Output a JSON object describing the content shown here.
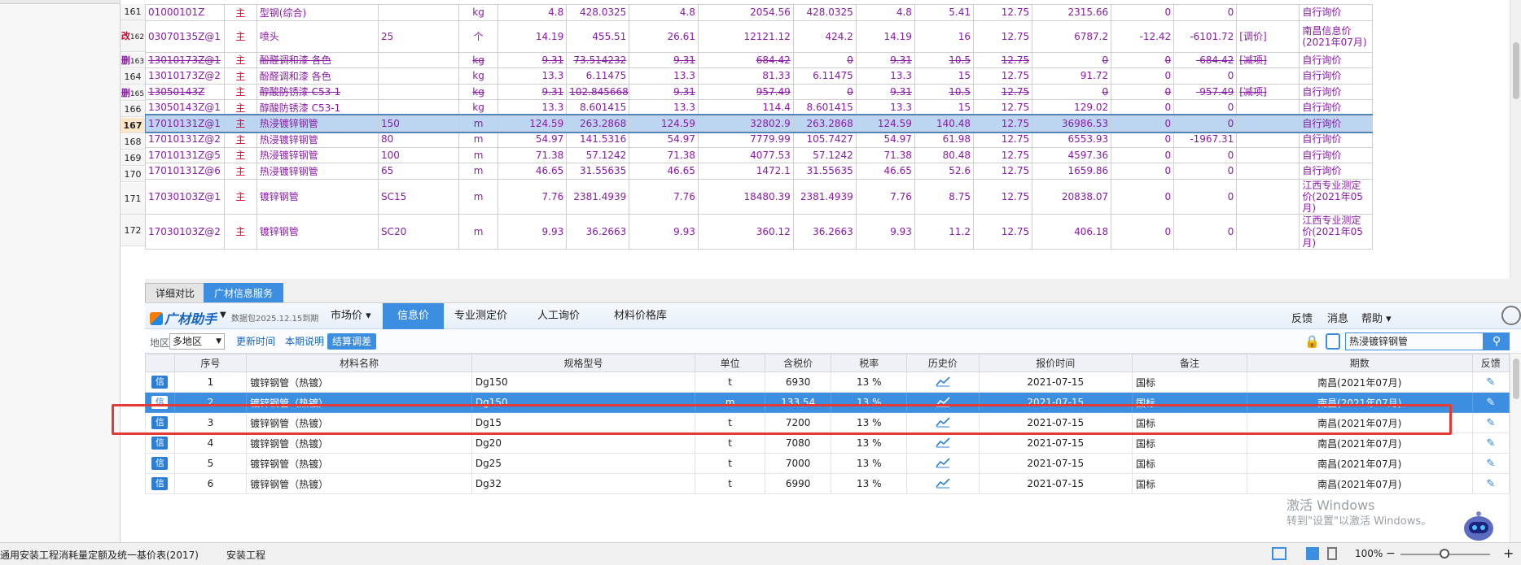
{
  "top_rows": [
    {
      "no": "161",
      "code": "01000101Z",
      "kind": "主",
      "name": "型钢(综合)",
      "spec": "",
      "unit": "kg",
      "v1": "4.8",
      "v2": "428.0325",
      "v3": "4.8",
      "v4": "2054.56",
      "v5": "428.0325",
      "v6": "4.8",
      "v7": "5.41",
      "v8": "12.75",
      "v9": "2315.66",
      "v10": "0",
      "v11": "0",
      "v12": "",
      "src": "自行询价",
      "style": "normal"
    },
    {
      "no": "162",
      "mark": "改",
      "code": "03070135Z@1",
      "kind": "主",
      "name": "喷头",
      "spec": "25",
      "unit": "个",
      "v1": "14.19",
      "v2": "455.51",
      "v3": "26.61",
      "v4": "12121.12",
      "v5": "424.2",
      "v6": "14.19",
      "v7": "16",
      "v8": "12.75",
      "v9": "6787.2",
      "v10": "-12.42",
      "v11": "-6101.72",
      "v12": "[调价]",
      "src": "南昌信息价(2021年07月)",
      "style": "tall"
    },
    {
      "no": "163",
      "mark": "删",
      "code": "13010173Z@1",
      "kind": "主",
      "name": "酚醛调和漆 各色",
      "spec": "",
      "unit": "kg",
      "v1": "9.31",
      "v2": "73.514232",
      "v3": "9.31",
      "v4": "684.42",
      "v5": "0",
      "v6": "9.31",
      "v7": "10.5",
      "v8": "12.75",
      "v9": "0",
      "v10": "0",
      "v11": "-684.42",
      "v12": "[减项]",
      "src": "自行询价",
      "style": "strike"
    },
    {
      "no": "164",
      "code": "13010173Z@2",
      "kind": "主",
      "name": "酚醛调和漆 各色",
      "spec": "",
      "unit": "kg",
      "v1": "13.3",
      "v2": "6.11475",
      "v3": "13.3",
      "v4": "81.33",
      "v5": "6.11475",
      "v6": "13.3",
      "v7": "15",
      "v8": "12.75",
      "v9": "91.72",
      "v10": "0",
      "v11": "0",
      "v12": "",
      "src": "自行询价",
      "style": "normal"
    },
    {
      "no": "165",
      "mark": "删",
      "code": "13050143Z",
      "kind": "主",
      "name": "醇酸防锈漆 C53-1",
      "spec": "",
      "unit": "kg",
      "v1": "9.31",
      "v2": "102.845668",
      "v3": "9.31",
      "v4": "957.49",
      "v5": "0",
      "v6": "9.31",
      "v7": "10.5",
      "v8": "12.75",
      "v9": "0",
      "v10": "0",
      "v11": "-957.49",
      "v12": "[减项]",
      "src": "自行询价",
      "style": "strike"
    },
    {
      "no": "166",
      "code": "13050143Z@1",
      "kind": "主",
      "name": "醇酸防锈漆 C53-1",
      "spec": "",
      "unit": "kg",
      "v1": "13.3",
      "v2": "8.601415",
      "v3": "13.3",
      "v4": "114.4",
      "v5": "8.601415",
      "v6": "13.3",
      "v7": "15",
      "v8": "12.75",
      "v9": "129.02",
      "v10": "0",
      "v11": "0",
      "v12": "",
      "src": "自行询价",
      "style": "normal"
    },
    {
      "no": "167",
      "code": "17010131Z@1",
      "kind": "主",
      "name": "热浸镀锌钢管",
      "spec": "150",
      "unit": "m",
      "v1": "124.59",
      "v2": "263.2868",
      "v3": "124.59",
      "v4": "32802.9",
      "v5": "263.2868",
      "v6": "124.59",
      "v7": "140.48",
      "v8": "12.75",
      "v9": "36986.53",
      "v10": "0",
      "v11": "0",
      "v12": "",
      "src": "自行询价",
      "style": "selected"
    },
    {
      "no": "168",
      "code": "17010131Z@2",
      "kind": "主",
      "name": "热浸镀锌钢管",
      "spec": "80",
      "unit": "m",
      "v1": "54.97",
      "v2": "141.5316",
      "v3": "54.97",
      "v4": "7779.99",
      "v5": "105.7427",
      "v6": "54.97",
      "v7": "61.98",
      "v8": "12.75",
      "v9": "6553.93",
      "v10": "0",
      "v11": "-1967.31",
      "v12": "",
      "src": "自行询价",
      "style": "normal"
    },
    {
      "no": "169",
      "code": "17010131Z@5",
      "kind": "主",
      "name": "热浸镀锌钢管",
      "spec": "100",
      "unit": "m",
      "v1": "71.38",
      "v2": "57.1242",
      "v3": "71.38",
      "v4": "4077.53",
      "v5": "57.1242",
      "v6": "71.38",
      "v7": "80.48",
      "v8": "12.75",
      "v9": "4597.36",
      "v10": "0",
      "v11": "0",
      "v12": "",
      "src": "自行询价",
      "style": "normal"
    },
    {
      "no": "170",
      "code": "17010131Z@6",
      "kind": "主",
      "name": "热浸镀锌钢管",
      "spec": "65",
      "unit": "m",
      "v1": "46.65",
      "v2": "31.55635",
      "v3": "46.65",
      "v4": "1472.1",
      "v5": "31.55635",
      "v6": "46.65",
      "v7": "52.6",
      "v8": "12.75",
      "v9": "1659.86",
      "v10": "0",
      "v11": "0",
      "v12": "",
      "src": "自行询价",
      "style": "normal"
    },
    {
      "no": "171",
      "code": "17030103Z@1",
      "kind": "主",
      "name": "镀锌钢管",
      "spec": "SC15",
      "unit": "m",
      "v1": "7.76",
      "v2": "2381.4939",
      "v3": "7.76",
      "v4": "18480.39",
      "v5": "2381.4939",
      "v6": "7.76",
      "v7": "8.75",
      "v8": "12.75",
      "v9": "20838.07",
      "v10": "0",
      "v11": "0",
      "v12": "",
      "src": "江西专业测定价(2021年05月)",
      "style": "tall"
    },
    {
      "no": "172",
      "code": "17030103Z@2",
      "kind": "主",
      "name": "镀锌钢管",
      "spec": "SC20",
      "unit": "m",
      "v1": "9.93",
      "v2": "36.2663",
      "v3": "9.93",
      "v4": "360.12",
      "v5": "36.2663",
      "v6": "9.93",
      "v7": "11.2",
      "v8": "12.75",
      "v9": "406.18",
      "v10": "0",
      "v11": "0",
      "v12": "",
      "src": "江西专业测定价(2021年05月)",
      "style": "tall"
    }
  ],
  "bottom_tabs": {
    "detail": "详细对比",
    "service": "广材信息服务"
  },
  "assistant": {
    "logo": "广材助手",
    "data_pkg": "数据包2025.12.15到期",
    "nav": [
      "市场价 ▾",
      "信息价",
      "专业测定价",
      "人工询价",
      "材料价格库"
    ],
    "right": [
      "反馈",
      "消息",
      "帮助 ▾"
    ]
  },
  "filters": {
    "region_label": "地区",
    "region_value": "多地区",
    "update_time": "更新时间",
    "period_note": "本期说明",
    "settle": "结算调差",
    "search_value": "热浸镀锌钢管"
  },
  "lower_headers": [
    "序号",
    "材料名称",
    "规格型号",
    "单位",
    "含税价",
    "税率",
    "历史价",
    "报价时间",
    "备注",
    "期数",
    "反馈"
  ],
  "lower_rows": [
    {
      "no": "1",
      "name": "镀锌钢管（热镀）",
      "spec": "Dg150",
      "unit": "t",
      "price": "6930",
      "tax": "13 %",
      "date": "2021-07-15",
      "note": "国标",
      "period": "南昌(2021年07月)"
    },
    {
      "no": "2",
      "name": "镀锌钢管（热镀）",
      "spec": "Dg150",
      "unit": "m",
      "price": "133.54",
      "tax": "13 %",
      "date": "2021-07-15",
      "note": "国标",
      "period": "南昌(2021年07月)",
      "selected": true
    },
    {
      "no": "3",
      "name": "镀锌钢管（热镀）",
      "spec": "Dg15",
      "unit": "t",
      "price": "7200",
      "tax": "13 %",
      "date": "2021-07-15",
      "note": "国标",
      "period": "南昌(2021年07月)"
    },
    {
      "no": "4",
      "name": "镀锌钢管（热镀）",
      "spec": "Dg20",
      "unit": "t",
      "price": "7080",
      "tax": "13 %",
      "date": "2021-07-15",
      "note": "国标",
      "period": "南昌(2021年07月)"
    },
    {
      "no": "5",
      "name": "镀锌钢管（热镀）",
      "spec": "Dg25",
      "unit": "t",
      "price": "7000",
      "tax": "13 %",
      "date": "2021-07-15",
      "note": "国标",
      "period": "南昌(2021年07月)"
    },
    {
      "no": "6",
      "name": "镀锌钢管（热镀）",
      "spec": "Dg32",
      "unit": "t",
      "price": "6990",
      "tax": "13 %",
      "date": "2021-07-15",
      "note": "国标",
      "period": "南昌(2021年07月)"
    }
  ],
  "xin_label": "信",
  "status": {
    "left": "通用安装工程消耗量定额及统一基价表(2017)",
    "mid": "安装工程",
    "zoom": "100%"
  },
  "watermark": {
    "line1": "激活 Windows",
    "line2": "转到\"设置\"以激活 Windows。"
  },
  "colors": {
    "accent": "#3c8ee0",
    "highlight_box": "#e53935",
    "code_purple": "#8b1aa9"
  }
}
